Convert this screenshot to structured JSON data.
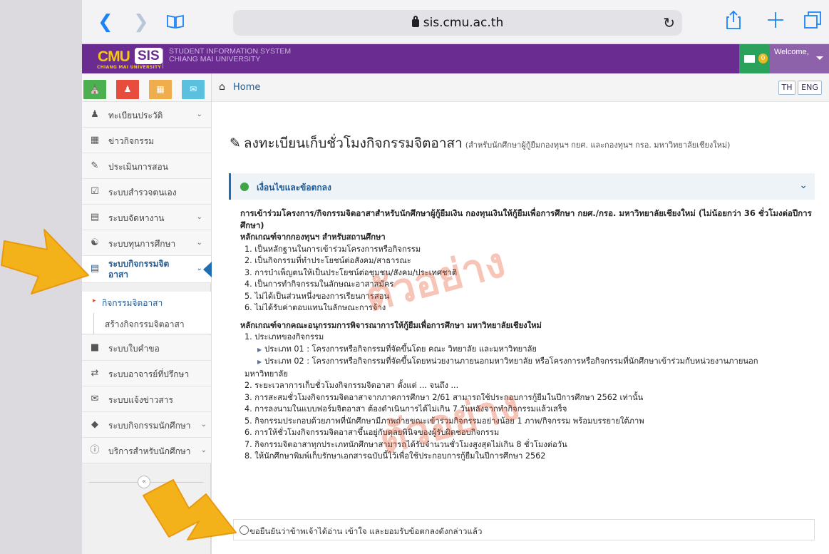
{
  "browser": {
    "url": "sis.cmu.ac.th",
    "back_icon": "chevron-left-icon",
    "forward_icon": "chevron-right-icon",
    "bookmarks_icon": "book-icon",
    "reload_icon": "reload-icon",
    "share_icon": "share-icon",
    "new_tab_icon": "plus-icon",
    "tabs_icon": "tabs-icon"
  },
  "header": {
    "logo_cmu": "CMU",
    "logo_sis": "SIS",
    "logo_sub": "CHIANG MAI UNIVERSITY",
    "system_title_line1": "STUDENT INFORMATION SYSTEM",
    "system_title_line2": "CHIANG MAI UNIVERSITY",
    "mail_count": "0",
    "welcome": "Welcome,",
    "colors": {
      "bar": "#6a2c91",
      "mail": "#2aa25b",
      "badge": "#e8b821",
      "welcome": "#8e62ab"
    }
  },
  "sidebar": {
    "shortcuts": [
      {
        "icon": "home-icon",
        "color": "#4caf50"
      },
      {
        "icon": "user-icon",
        "color": "#e74c3c"
      },
      {
        "icon": "calendar-icon",
        "color": "#f0ad4e"
      },
      {
        "icon": "mail-icon",
        "color": "#5bc0de"
      }
    ],
    "items": [
      {
        "label": "ทะเบียนประวัติ",
        "icon": "user-icon",
        "caret": true
      },
      {
        "label": "ข่าวกิจกรรม",
        "icon": "calendar-icon",
        "caret": false
      },
      {
        "label": "ประเมินการสอน",
        "icon": "edit-icon",
        "caret": false
      },
      {
        "label": "ระบบสำรวจตนเอง",
        "icon": "checkbox-icon",
        "caret": false
      },
      {
        "label": "ระบบจัดหางาน",
        "icon": "briefcase-icon",
        "caret": true
      },
      {
        "label": "ระบบทุนการศึกษา",
        "icon": "bank-icon",
        "caret": true
      },
      {
        "label": "ระบบกิจกรรมจิตอาสา",
        "icon": "list-icon",
        "caret": true,
        "active": true
      }
    ],
    "subitems": [
      {
        "label": "กิจกรรมจิตอาสา",
        "active": true
      },
      {
        "label": "สร้างกิจกรรมจิตอาสา",
        "active": false
      }
    ],
    "items_after": [
      {
        "label": "ระบบใบคำขอ",
        "icon": "file-icon",
        "caret": false
      },
      {
        "label": "ระบบอาจารย์ที่ปรึกษา",
        "icon": "exchange-icon",
        "caret": false
      },
      {
        "label": "ระบบแจ้งข่าวสาร",
        "icon": "envelope-icon",
        "caret": false
      },
      {
        "label": "ระบบกิจกรรมนักศึกษา",
        "icon": "tag-icon",
        "caret": true
      },
      {
        "label": "บริการสำหรับนักศึกษา",
        "icon": "info-icon",
        "caret": true
      }
    ]
  },
  "breadcrumb": {
    "home": "Home",
    "lang_th": "TH",
    "lang_en": "ENG"
  },
  "page": {
    "title": "ลงทะเบียนเก็บชั่วโมงกิจกรรมจิตอาสา",
    "subtitle": "(สำหรับนักศึกษาผู้กู้ยืมกองทุนฯ กยศ. และกองทุนฯ กรอ. มหาวิทยาลัยเชียงใหม่)",
    "panel_title": "เงื่อนไขและข้อตกลง",
    "intro": "การเข้าร่วมโครงการ/กิจกรรมจิตอาสาสำหรับนักศึกษาผู้กู้ยืมเงิน กองทุนเงินให้กู้ยืมเพื่อการศึกษา กยศ./กรอ. มหาวิทยาลัยเชียงใหม่ (ไม่น้อยกว่า 36 ชั่วโมงต่อปีการศึกษา)",
    "fund_heading": "หลักเกณฑ์จากกองทุนฯ สำหรับสถานศึกษา",
    "fund_rules": [
      "1. เป็นหลักฐานในการเข้าร่วมโครงการหรือกิจกรรม",
      "2. เป็นกิจกรรมที่ทำประโยชน์ต่อสังคม/สาธารณะ",
      "3. การบำเพ็ญตนให้เป็นประโยชน์ต่อชุมชน/สังคม/ประเทศชาติ",
      "4. เป็นการทำกิจกรรมในลักษณะอาสาสมัคร",
      "5. ไม่ได้เป็นส่วนหนึ่งของการเรียนการสอน",
      "6. ไม่ได้รับค่าตอบแทนในลักษณะการจ้าง"
    ],
    "committee_heading": "หลักเกณฑ์จากคณะอนุกรรมการพิจารณาการให้กู้ยืมเพื่อการศึกษา มหาวิทยาลัยเชียงใหม่",
    "committee_rule1": "1. ประเภทของกิจกรรม",
    "type1": "ประเภท 01 : โครงการหรือกิจกรรมที่จัดขึ้นโดย คณะ วิทยาลัย และมหาวิทยาลัย",
    "type2": "ประเภท 02 : โครงการหรือกิจกรรมที่จัดขึ้นโดยหน่วยงานภายนอกมหาวิทยาลัย หรือโครงการหรือกิจกรรมที่นักศึกษาเข้าร่วมกับหน่วยงานภายนอก",
    "type2_cont": "มหาวิทยาลัย",
    "committee_rules": [
      "2. ระยะเวลาการเก็บชั่วโมงกิจกรรมจิตอาสา ตั้งแต่ ... จนถึง ...",
      "3. การสะสมชั่วโมงกิจกรรมจิตอาสาจากภาคการศึกษา 2/61 สามารถใช้ประกอบการกู้ยืมในปีการศึกษา 2562 เท่านั้น",
      "4. การลงนามในแบบฟอร์มจิตอาสา ต้องดำเนินการได้ไม่เกิน 7 วันหลังจากทำกิจกรรมแล้วเสร็จ",
      "5. กิจกรรมประกอบด้วยภาพที่นักศึกษามีภาพถ่ายขณะเข้าร่วมกิจกรรมอย่างน้อย 1 ภาพ/กิจกรรม พร้อมบรรยายใต้ภาพ",
      "6. การให้ชั่วโมงกิจกรรมจิตอาสาขึ้นอยู่กับดุลยพินิจของผู้รับผิดชอบกิจกรรม",
      "7. กิจกรรมจิตอาสาทุกประเภทนักศึกษาสามารถได้รับจำนวนชั่วโมงสูงสุดไม่เกิน 8 ชั่วโมงต่อวัน",
      "8. ให้นักศึกษาพิมพ์เก็บรักษาเอกสารฉบับนี้ไว้เพื่อใช้ประกอบการกู้ยืมในปีการศึกษา 2562"
    ],
    "agree_label": "ขอยืนยันว่าข้าพเจ้าได้อ่าน เข้าใจ และยอมรับข้อตกลงดังกล่าวแล้ว"
  },
  "watermark": "ตัวอย่าง",
  "annotation_color": "#f4b21a"
}
